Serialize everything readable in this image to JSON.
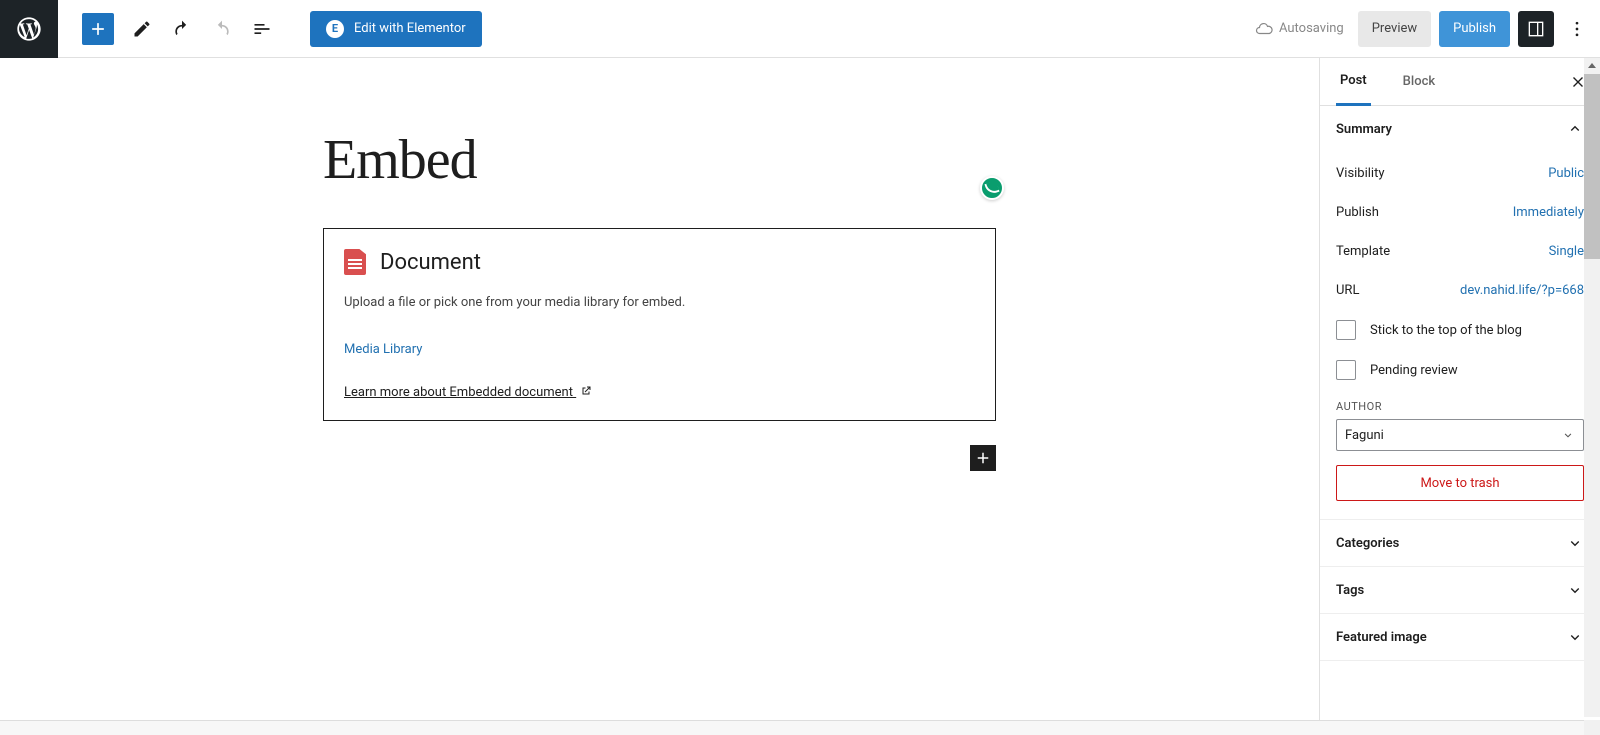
{
  "toolbar": {
    "elementor_label": "Edit with Elementor",
    "autosave_label": "Autosaving",
    "preview_label": "Preview",
    "publish_label": "Publish"
  },
  "editor": {
    "title": "Embed",
    "block": {
      "title": "Document",
      "description": "Upload a file or pick one from your media library for embed.",
      "media_library_label": "Media Library",
      "learn_more_label": "Learn more about Embedded document "
    }
  },
  "sidebar": {
    "tabs": {
      "post": "Post",
      "block": "Block"
    },
    "summary": {
      "title": "Summary",
      "visibility": {
        "label": "Visibility",
        "value": "Public"
      },
      "publish": {
        "label": "Publish",
        "value": "Immediately"
      },
      "template": {
        "label": "Template",
        "value": "Single"
      },
      "url": {
        "label": "URL",
        "value": "dev.nahid.life/?p=668"
      },
      "sticky_label": "Stick to the top of the blog",
      "pending_label": "Pending review",
      "author_section_label": "AUTHOR",
      "author_value": "Faguni",
      "trash_label": "Move to trash"
    },
    "panels": {
      "categories": "Categories",
      "tags": "Tags",
      "featured_image": "Featured image"
    }
  }
}
